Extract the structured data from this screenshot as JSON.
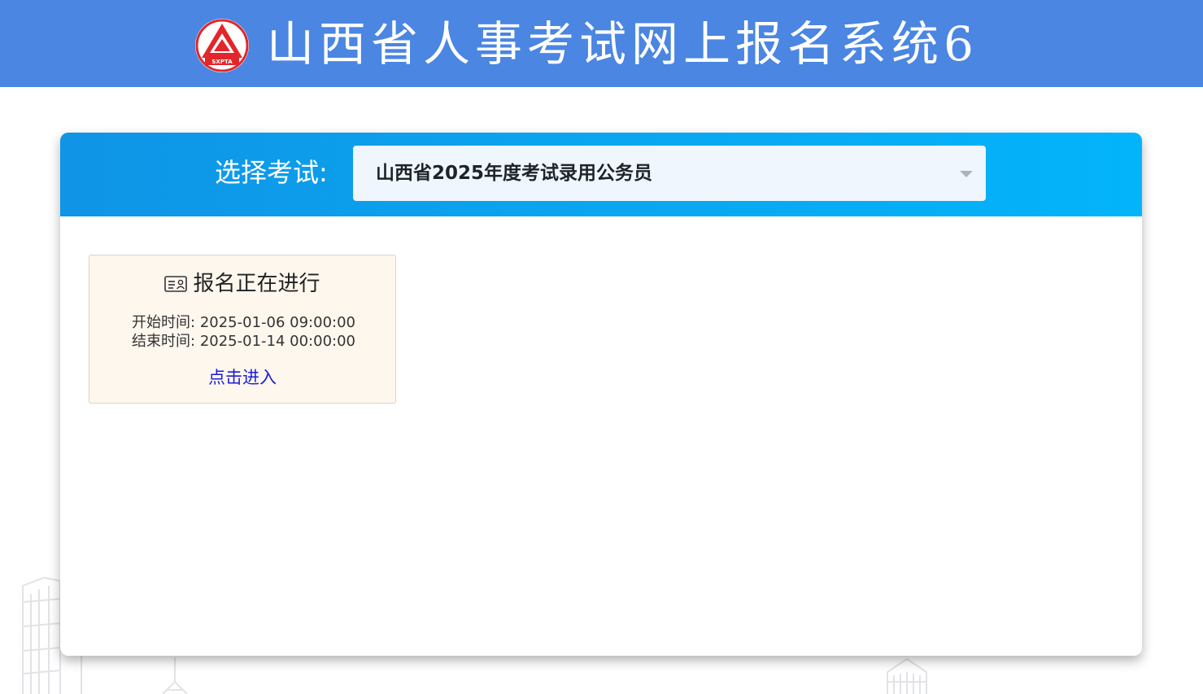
{
  "header": {
    "logo_text": "SXPTA",
    "title": "山西省人事考试网上报名系统6"
  },
  "exam_selector": {
    "label": "选择考试:",
    "selected": "山西省2025年度考试录用公务员"
  },
  "status_card": {
    "title": "报名正在进行",
    "start_label": "开始时间:",
    "start_time": "2025-01-06 09:00:00",
    "end_label": "结束时间:",
    "end_time": "2025-01-14 00:00:00",
    "enter_link": "点击进入"
  },
  "colors": {
    "header_bg": "#4a86e2",
    "card_head_start": "#0f94e6",
    "card_head_end": "#03b4fb",
    "status_bg": "#fdf7ee",
    "link": "#1d1dd6",
    "logo_red": "#e2262a"
  },
  "icons": {
    "logo": "sxpta-emblem-icon",
    "status": "id-card-icon",
    "dropdown": "chevron-down-icon"
  }
}
